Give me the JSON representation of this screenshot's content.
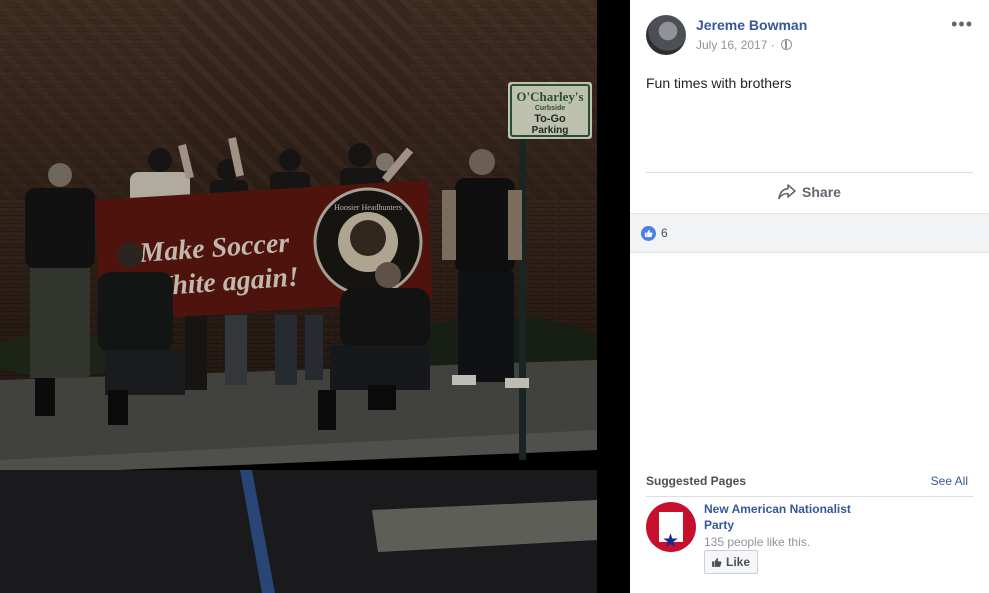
{
  "post": {
    "author": "Jereme Bowman",
    "date": "July 16, 2017",
    "date_separator": "·",
    "text": "Fun times with brothers",
    "more_glyph": "•••",
    "share_label": "Share",
    "like_count": "6"
  },
  "photo": {
    "banner_text_line1": "Make Soccer",
    "banner_text_line2": "White again!",
    "banner_badge_text": "Hoosier Headhunters",
    "sign_line1": "O'Charley's",
    "sign_line2": "Curbside",
    "sign_line3": "To-Go",
    "sign_line4": "Parking"
  },
  "suggested": {
    "title": "Suggested Pages",
    "see_all": "See All",
    "page_name": "New American Nationalist Party",
    "page_likes": "135 people like this.",
    "like_button": "Like"
  },
  "icons": {
    "globe": "globe-icon",
    "share": "share-icon",
    "like_reaction": "thumbs-up-icon",
    "like_button": "thumbs-up-icon"
  },
  "colors": {
    "link_blue": "#365899",
    "reaction_blue": "#4e7fe6",
    "banner_red": "#7a1e16",
    "page_avatar_red": "#c8102e"
  }
}
